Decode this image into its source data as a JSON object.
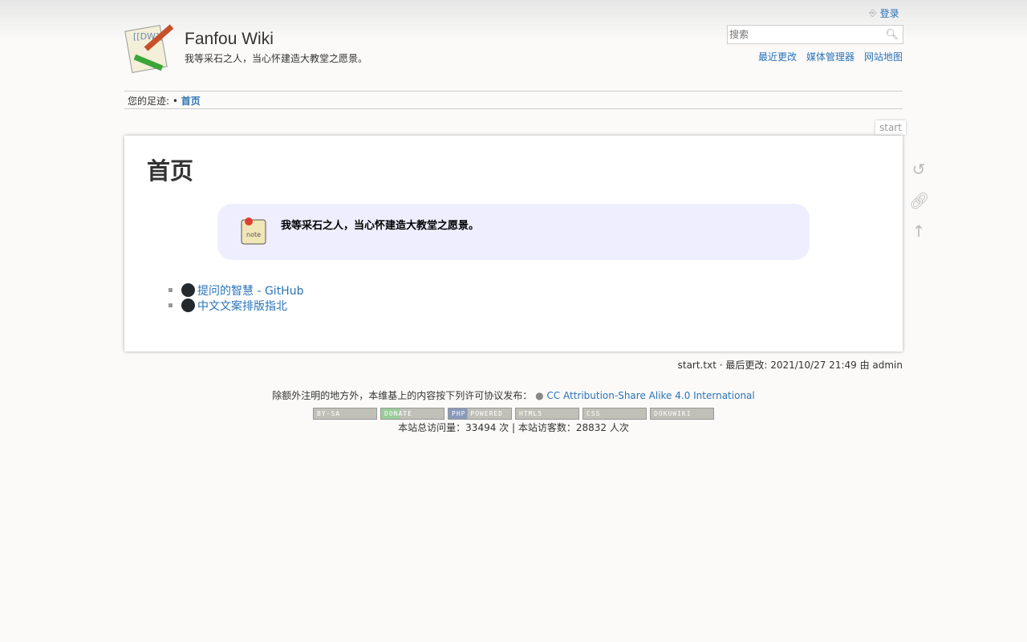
{
  "header": {
    "title": "Fanfou Wiki",
    "tagline": "我等采石之人，当心怀建造大教堂之愿景。",
    "login": "登录",
    "search_placeholder": "搜索",
    "tools": [
      "最近更改",
      "媒体管理器",
      "网站地图"
    ]
  },
  "breadcrumbs": {
    "label": "您的足迹:",
    "sep": "•",
    "current": "首页"
  },
  "page": {
    "id": "start",
    "heading": "首页",
    "note": "我等采石之人，当心怀建造大教堂之愿景。",
    "links": [
      "提问的智慧 - GitHub",
      "中文文案排版指北"
    ]
  },
  "docinfo": "start.txt · 最后更改: 2021/10/27 21:49 由 admin",
  "footer": {
    "license_prefix": "除额外注明的地方外，本维基上的内容按下列许可协议发布：",
    "license_link": "CC Attribution-Share Alike 4.0 International",
    "badges": [
      "BY-SA",
      "DONATE",
      "PHP POWERED",
      "HTML5",
      "CSS",
      "DOKUWIKI"
    ],
    "stats": "本站总访问量：33494 次 | 本站访客数：28832 人次"
  }
}
